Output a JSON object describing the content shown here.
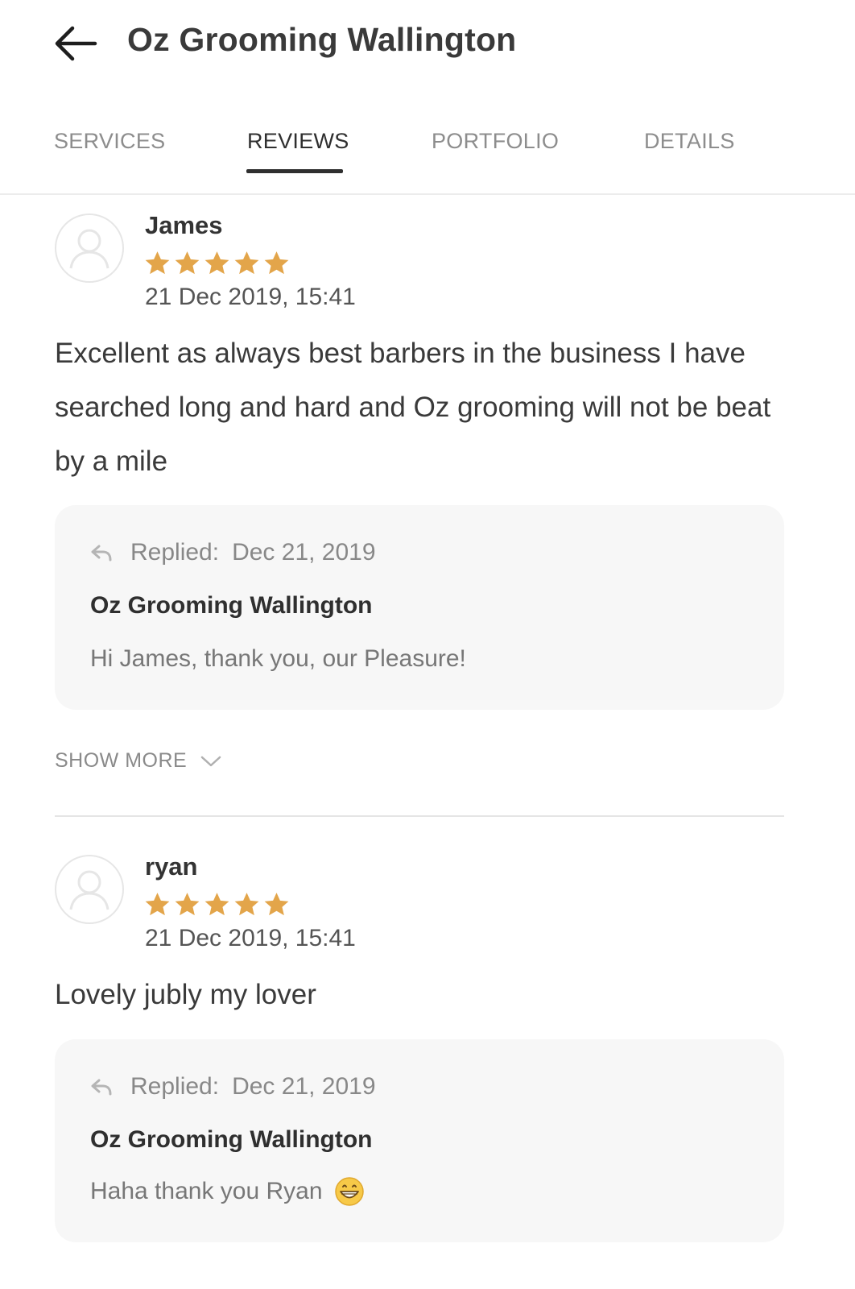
{
  "header": {
    "title": "Oz Grooming Wallington"
  },
  "tabs": [
    {
      "label": "SERVICES",
      "active": false
    },
    {
      "label": "REVIEWS",
      "active": true
    },
    {
      "label": "PORTFOLIO",
      "active": false
    },
    {
      "label": "DETAILS",
      "active": false
    }
  ],
  "reviews": [
    {
      "name": "James",
      "rating": 5,
      "date": "21 Dec 2019, 15:41",
      "text": "Excellent as always best barbers in the business I have searched long and hard and Oz grooming will not be beat by a mile",
      "reply": {
        "label": "Replied:",
        "date": "Dec 21, 2019",
        "owner": "Oz Grooming Wallington",
        "text": "Hi James, thank you, our Pleasure!"
      },
      "show_more": "SHOW MORE"
    },
    {
      "name": "ryan",
      "rating": 5,
      "date": "21 Dec 2019, 15:41",
      "text": "Lovely jubly my lover",
      "reply": {
        "label": "Replied:",
        "date": "Dec 21, 2019",
        "owner": "Oz Grooming Wallington",
        "text": "Haha thank you Ryan",
        "emoji": "grinning-face-emoji"
      }
    }
  ],
  "colors": {
    "star": "#e3a54a",
    "text": "#3a3a3a",
    "muted": "#8a8a8a",
    "reply_bg": "#f7f7f7"
  }
}
